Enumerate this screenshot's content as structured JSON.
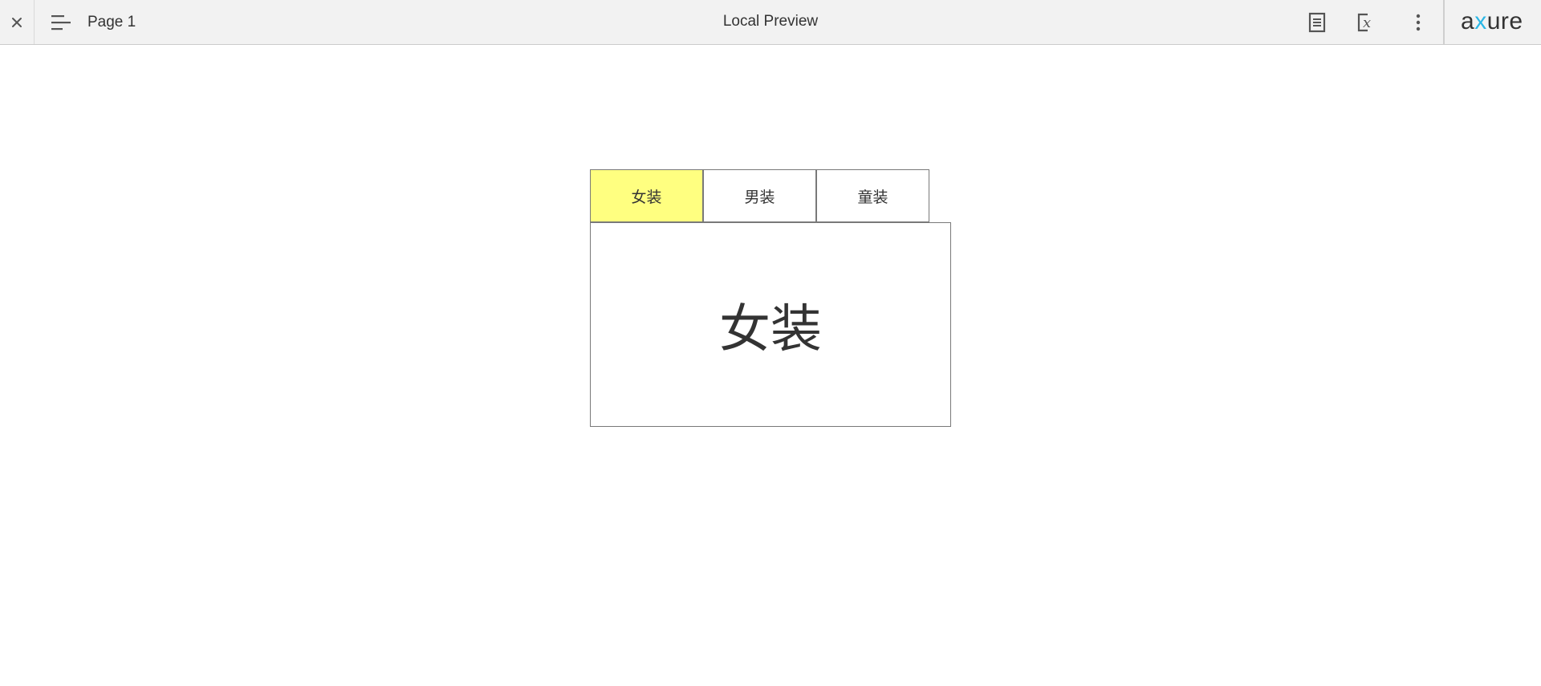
{
  "toolbar": {
    "page_name": "Page 1",
    "title": "Local Preview",
    "logo_prefix": "a",
    "logo_x": "x",
    "logo_suffix": "ure",
    "icons": {
      "close": "close-icon",
      "menu": "menu-icon",
      "notes": "notes-icon",
      "variables": "variables-icon",
      "more": "more-vertical-icon"
    }
  },
  "tabs": [
    {
      "label": "女装",
      "selected": true
    },
    {
      "label": "男装",
      "selected": false
    },
    {
      "label": "童装",
      "selected": false
    }
  ],
  "panel": {
    "text": "女装"
  },
  "colors": {
    "selected_tab": "#ffff80",
    "border": "#797979",
    "toolbar_bg": "#f2f2f2",
    "logo_accent": "#2ab7e6"
  }
}
